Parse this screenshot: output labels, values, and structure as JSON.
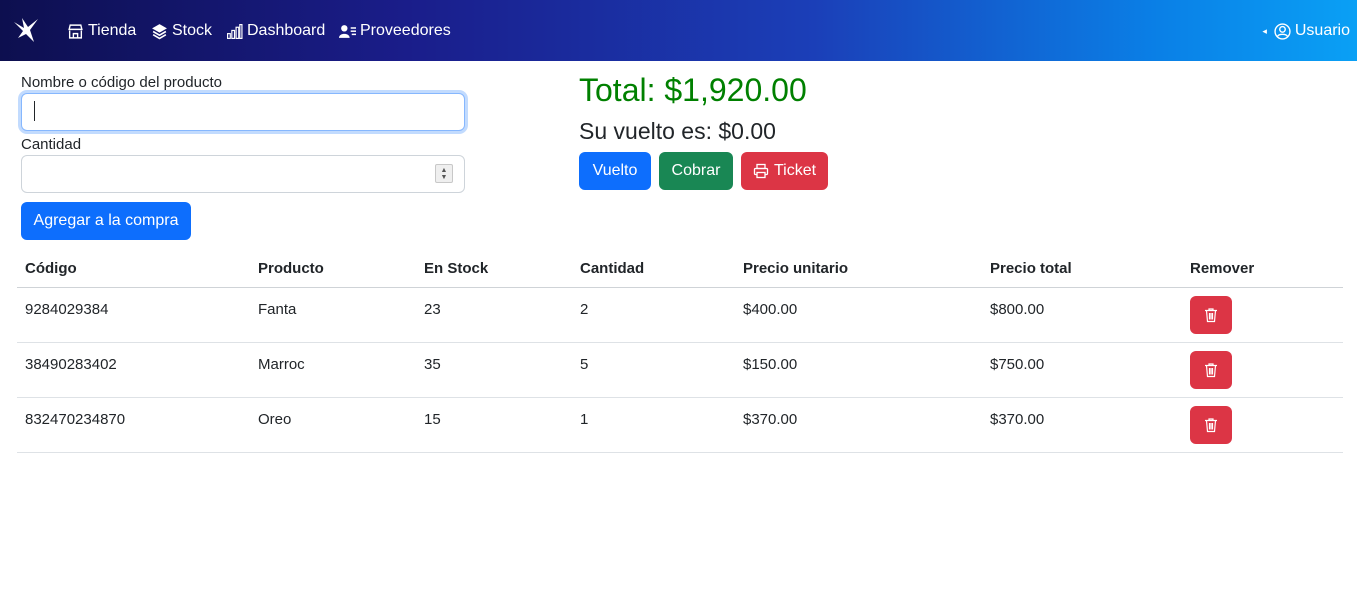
{
  "nav": {
    "brand_icon": "bird-logo-icon",
    "items": [
      {
        "label": "Tienda",
        "icon": "shop-icon"
      },
      {
        "label": "Stock",
        "icon": "layers-icon"
      },
      {
        "label": "Dashboard",
        "icon": "bar-chart-icon"
      },
      {
        "label": "Proveedores",
        "icon": "person-list-icon"
      }
    ],
    "user": {
      "label": "Usuario",
      "icon": "person-circle-icon",
      "caret": "◂"
    }
  },
  "form": {
    "product_label": "Nombre o código del producto",
    "product_value": "",
    "quantity_label": "Cantidad",
    "quantity_value": "",
    "add_button": "Agregar a la compra"
  },
  "summary": {
    "total": "Total: $1,920.00",
    "change": "Su vuelto es: $0.00",
    "buttons": {
      "vuelto": "Vuelto",
      "cobrar": "Cobrar",
      "ticket": "Ticket"
    }
  },
  "table": {
    "headers": [
      "Código",
      "Producto",
      "En Stock",
      "Cantidad",
      "Precio unitario",
      "Precio total",
      "Remover"
    ],
    "rows": [
      {
        "codigo": "9284029384",
        "producto": "Fanta",
        "stock": "23",
        "cantidad": "2",
        "unitario": "$400.00",
        "total": "$800.00"
      },
      {
        "codigo": "38490283402",
        "producto": "Marroc",
        "stock": "35",
        "cantidad": "5",
        "unitario": "$150.00",
        "total": "$750.00"
      },
      {
        "codigo": "832470234870",
        "producto": "Oreo",
        "stock": "15",
        "cantidad": "1",
        "unitario": "$370.00",
        "total": "$370.00"
      }
    ]
  },
  "colors": {
    "primary": "#0d6efd",
    "success": "#198754",
    "danger": "#dc3545",
    "total_text": "#008000"
  }
}
